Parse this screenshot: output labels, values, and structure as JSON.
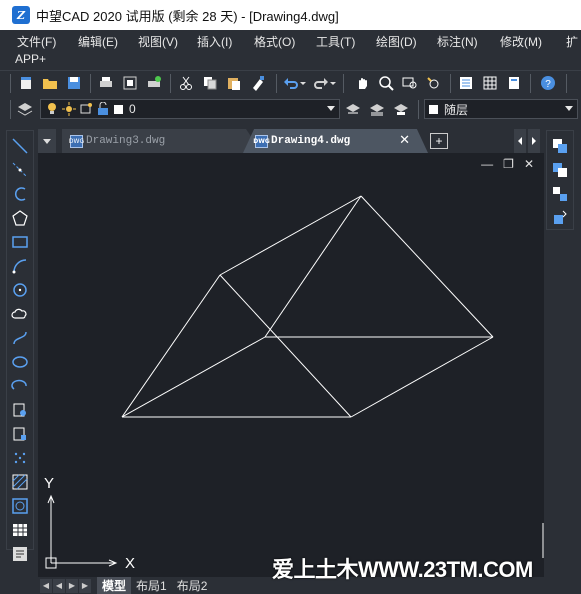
{
  "window": {
    "title": "中望CAD 2020 试用版 (剩余 28 天) - [Drawing4.dwg]",
    "logo_text": "Z"
  },
  "menu": {
    "row1": [
      "文件(F)",
      "编辑(E)",
      "视图(V)",
      "插入(I)",
      "格式(O)",
      "工具(T)",
      "绘图(D)",
      "标注(N)",
      "修改(M)",
      "扩"
    ],
    "row2": [
      "APP+"
    ]
  },
  "layer_bar": {
    "layer_value": "0",
    "linetype_value": "随层"
  },
  "tabs": [
    {
      "label": "Drawing3.dwg",
      "active": false
    },
    {
      "label": "Drawing4.dwg",
      "active": true
    }
  ],
  "tab_badge": "DWG",
  "tab_close": "✕",
  "tab_add": "+",
  "canvas": {
    "window_controls": [
      "—",
      "❐",
      "✕"
    ],
    "ucs_y": "Y",
    "ucs_x": "X"
  },
  "layout_tabs": [
    {
      "label": "模型",
      "active": true
    },
    {
      "label": "布局1",
      "active": false
    },
    {
      "label": "布局2",
      "active": false
    }
  ],
  "nav_arrows": [
    "◀",
    "◀",
    "▶",
    "▶"
  ],
  "watermark": "爱上土木WWW.23TM.COM",
  "colors": {
    "background": "#2b2f36",
    "canvas": "#1e2127",
    "accent_blue": "#3d6fb3",
    "line": "#ffffff"
  }
}
